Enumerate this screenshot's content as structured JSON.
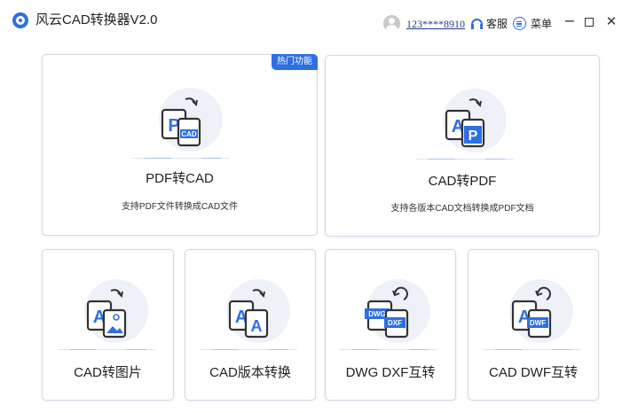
{
  "app": {
    "title": "风云CAD转换器V2.0",
    "username": "123****8910",
    "service_label": "客服",
    "menu_label": "菜单",
    "window_controls": {
      "minimize": "−",
      "close": "✕"
    }
  },
  "colors": {
    "accent": "#2f6fe4",
    "card_border": "#cfd8e3",
    "icon_bg": "#eef2f8"
  },
  "cards": [
    {
      "id": "pdf-to-cad",
      "title": "PDF转CAD",
      "description": "支持PDF文件转换成CAD文件",
      "badge": "热门功能",
      "icon": "pdf-to-cad-icon",
      "icon_letter": "P",
      "icon_tag": "CAD"
    },
    {
      "id": "cad-to-pdf",
      "title": "CAD转PDF",
      "description": "支持各版本CAD文档转换成PDF文档",
      "icon": "cad-to-pdf-icon",
      "icon_letter": "A",
      "icon_tag": "P"
    },
    {
      "id": "cad-to-image",
      "title": "CAD转图片",
      "icon": "cad-to-image-icon",
      "icon_letter": "A"
    },
    {
      "id": "cad-version-convert",
      "title": "CAD版本转换",
      "icon": "cad-version-convert-icon",
      "icon_letter": "A",
      "icon_tag": "A"
    },
    {
      "id": "dwg-dxf-convert",
      "title": "DWG DXF互转",
      "icon": "dwg-dxf-convert-icon",
      "icon_letter": "DWG",
      "icon_tag": "DXF"
    },
    {
      "id": "cad-dwf-convert",
      "title": "CAD DWF互转",
      "icon": "cad-dwf-convert-icon",
      "icon_letter": "A",
      "icon_tag": "DWF"
    }
  ]
}
